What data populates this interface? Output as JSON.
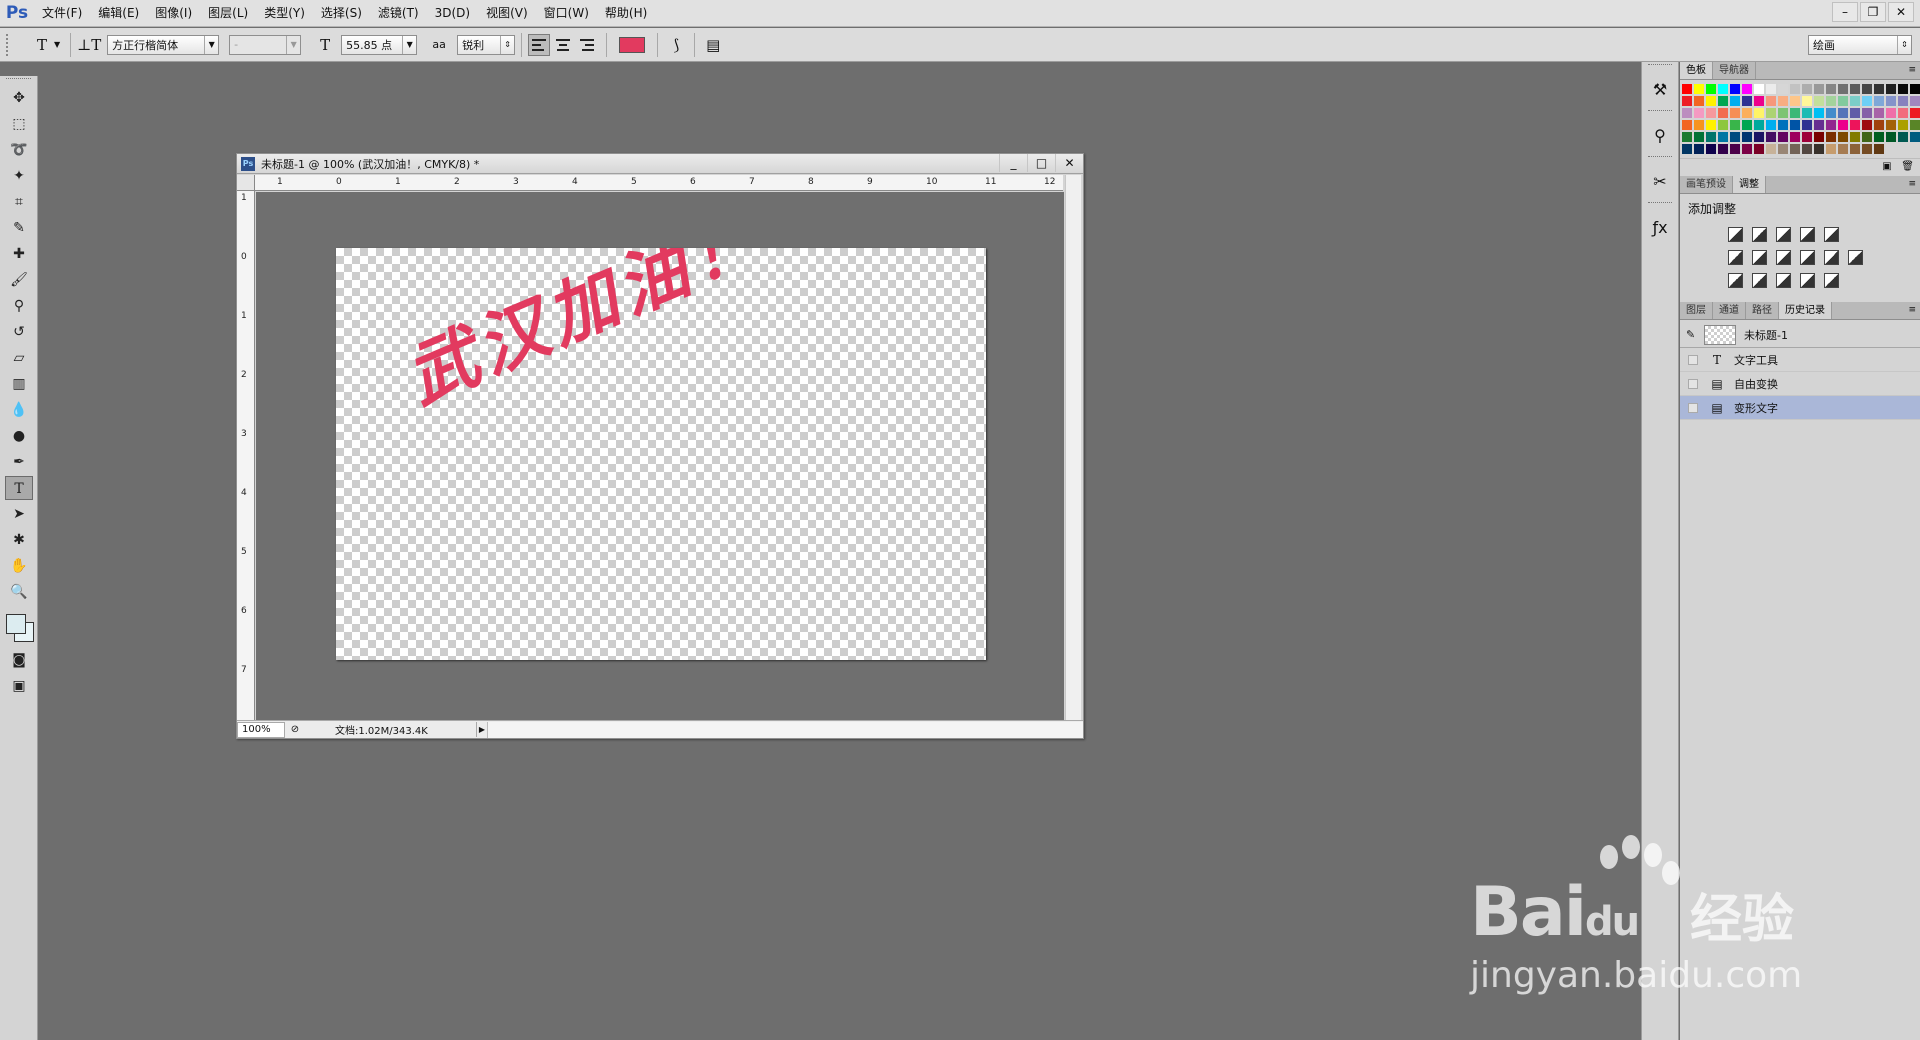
{
  "menubar": {
    "logo": "Ps",
    "items": [
      "文件(F)",
      "编辑(E)",
      "图像(I)",
      "图层(L)",
      "类型(Y)",
      "选择(S)",
      "滤镜(T)",
      "3D(D)",
      "视图(V)",
      "窗口(W)",
      "帮助(H)"
    ]
  },
  "options": {
    "font_family": "方正行楷简体",
    "font_style": "-",
    "font_size": "55.85 点",
    "aa_label": "aa",
    "antialias": "锐利",
    "text_color": "#e23a5f",
    "workspace": "绘画"
  },
  "document": {
    "title": "未标题-1 @ 100% (武汉加油！, CMYK/8) *",
    "ps_badge": "Ps",
    "ruler_h": [
      "1",
      "0",
      "1",
      "2",
      "3",
      "4",
      "5",
      "6",
      "7",
      "8",
      "9",
      "10",
      "11",
      "12"
    ],
    "ruler_v": [
      "1",
      "0",
      "1",
      "2",
      "3",
      "4",
      "5",
      "6",
      "7"
    ],
    "text": "武汉加油！",
    "zoom": "100%",
    "doc_info": "文档:1.02M/343.4K"
  },
  "panels": {
    "swatch_tabs": [
      "色板",
      "导航器"
    ],
    "swatch_colors": [
      "#ff0000",
      "#ffff00",
      "#00ff00",
      "#00ffff",
      "#0000ff",
      "#ff00ff",
      "#ffffff",
      "#ebebeb",
      "#d6d6d6",
      "#c2c2c2",
      "#adadad",
      "#999999",
      "#858585",
      "#707070",
      "#5c5c5c",
      "#474747",
      "#333333",
      "#1f1f1f",
      "#0a0a0a",
      "#000000",
      "#ed1c24",
      "#f26522",
      "#fff200",
      "#00a651",
      "#00aeef",
      "#2e3192",
      "#ec008c",
      "#f7977a",
      "#f9ad81",
      "#fdc68a",
      "#fff79a",
      "#c4df9b",
      "#a3d39c",
      "#82ca9d",
      "#7bcdc8",
      "#6ecff6",
      "#7ea7d8",
      "#8493ca",
      "#8882be",
      "#a187be",
      "#bc8dbf",
      "#f49ac2",
      "#f6989d",
      "#f26c4f",
      "#f68e55",
      "#fbaf5c",
      "#fff467",
      "#acd372",
      "#7dc473",
      "#3cb878",
      "#1cbbb4",
      "#00bff3",
      "#438ccb",
      "#5574b9",
      "#605ca8",
      "#855fa8",
      "#a763a8",
      "#f06ea9",
      "#f26d7d",
      "#ed1c24",
      "#f26522",
      "#f7941d",
      "#fff200",
      "#8dc73f",
      "#39b54a",
      "#00a651",
      "#00a99d",
      "#00aeef",
      "#0072bc",
      "#0054a6",
      "#2e3192",
      "#662d91",
      "#92278f",
      "#ec008c",
      "#ed145b",
      "#9e0b0f",
      "#a0410d",
      "#a36209",
      "#aba000",
      "#598527",
      "#1a7b30",
      "#007236",
      "#00746b",
      "#0076a3",
      "#004b80",
      "#003471",
      "#1b1464",
      "#440e62",
      "#630460",
      "#9e005d",
      "#9e0039",
      "#790000",
      "#7b2e00",
      "#7d4900",
      "#827b00",
      "#406618",
      "#005e20",
      "#005826",
      "#005952",
      "#005b7f",
      "#003663",
      "#002157",
      "#0d004c",
      "#32004b",
      "#4b0049",
      "#7b0046",
      "#7a0026",
      "#c7b299",
      "#998675",
      "#736357",
      "#534741",
      "#37302a",
      "#c69c6d",
      "#a67c52",
      "#8c6239",
      "#754c24",
      "#603913"
    ],
    "adj_tabs": [
      "画笔预设",
      "调整"
    ],
    "adj_title": "添加调整",
    "history_tabs": [
      "图层",
      "通道",
      "路径",
      "历史记录"
    ],
    "history_snapshot": "未标题-1",
    "history_items": [
      {
        "icon": "text-tool-icon",
        "glyph": "T",
        "label": "文字工具"
      },
      {
        "icon": "document-icon",
        "glyph": "▤",
        "label": "自由变换"
      },
      {
        "icon": "document-icon",
        "glyph": "▤",
        "label": "变形文字"
      }
    ]
  },
  "watermark": {
    "brand": "Bai",
    "brand2": "du",
    "cn": "经验",
    "url": "jingyan.baidu.com"
  }
}
